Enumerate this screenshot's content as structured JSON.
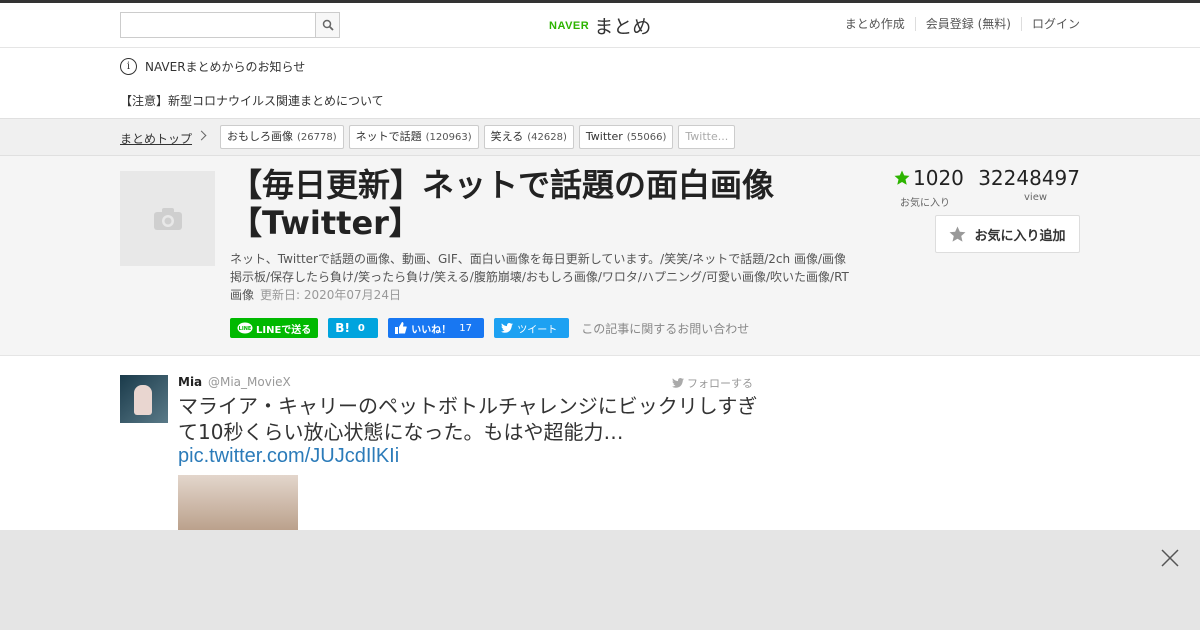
{
  "header": {
    "search_placeholder": "",
    "logo_naver": "NAVER",
    "logo_matome": "まとめ",
    "nav": [
      "まとめ作成",
      "会員登録 (無料)",
      "ログイン"
    ]
  },
  "notice": {
    "title": "NAVERまとめからのお知らせ",
    "link": "【注意】新型コロナウイルス関連まとめについて"
  },
  "breadcrumb": {
    "top": "まとめトップ",
    "tags": [
      {
        "label": "おもしろ画像",
        "count": "(26778)"
      },
      {
        "label": "ネットで話題",
        "count": "(120963)"
      },
      {
        "label": "笑える",
        "count": "(42628)"
      },
      {
        "label": "Twitter",
        "count": "(55066)"
      },
      {
        "label": "Twitte...",
        "count": ""
      }
    ]
  },
  "article": {
    "title": "【毎日更新】ネットで話題の面白画像【Twitter】",
    "description": "ネット、Twitterで話題の画像、動画、GIF、面白い画像を毎日更新しています。/笑笑/ネットで話題/2ch 画像/画像掲示板/保存したら負け/笑ったら負け/笑える/腹筋崩壊/おもしろ画像/ワロタ/ハプニング/可愛い画像/吹いた画像/RT画像",
    "updated": "更新日: 2020年07月24日",
    "favorites": "1020",
    "favorites_label": "お気に入り",
    "views": "32248497",
    "views_label": "view",
    "fav_button": "お気に入り追加"
  },
  "share": {
    "line": "LINEで送る",
    "hatena_icon": "B!",
    "hatena_count": "0",
    "fb_label": "いいね！",
    "fb_count": "17",
    "tweet": "ツイート",
    "inquiry": "この記事に関するお問い合わせ"
  },
  "tweet": {
    "name": "Mia",
    "handle": "@Mia_MovieX",
    "follow": "フォローする",
    "text": "マライア・キャリーのペットボトルチャレンジにビックリしすぎて10秒くらい放心状態になった。もはや超能力…",
    "link": "pic.twitter.com/JUJcdIlKIi"
  },
  "colors": {
    "naver_green": "#2db400",
    "line_green": "#00b900",
    "hatena_blue": "#00a4de",
    "fb_blue": "#1877f2",
    "twitter_blue": "#1da1f2",
    "link_blue": "#2b7bb9"
  }
}
